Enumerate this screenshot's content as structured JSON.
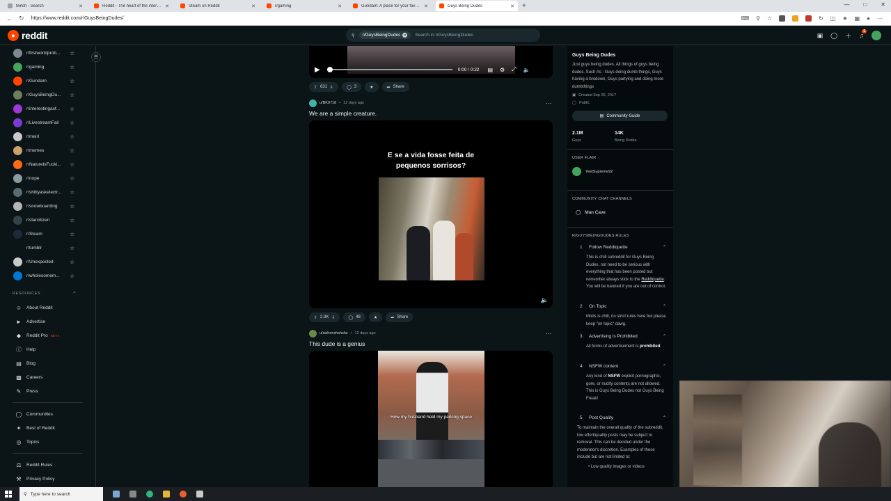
{
  "browser": {
    "tabs": [
      {
        "title": "twitch - Search",
        "color": "#9aa0a6",
        "active": false
      },
      {
        "title": "Reddit - The heart of the internet",
        "color": "#ff4500",
        "active": false
      },
      {
        "title": "Steam on Reddit",
        "color": "#ff4500",
        "active": false
      },
      {
        "title": "r/gaming",
        "color": "#ff4500",
        "active": false
      },
      {
        "title": "Gundam: A place for your favorit...",
        "color": "#ff4500",
        "active": false
      },
      {
        "title": "Guys Being Dudes",
        "color": "#ff4500",
        "active": true
      }
    ],
    "url": "https://www.reddit.com/r/GuysBeingDudes/"
  },
  "header": {
    "logo": "reddit",
    "search_chip": "r/GuysBeingDudes",
    "search_placeholder": "Search in r/GuysBeingDudes",
    "notif_count": "1"
  },
  "sidebar": {
    "communities": [
      {
        "name": "r/firstworldprob...",
        "color": "#7a8a90"
      },
      {
        "name": "r/gaming",
        "color": "#46a35e"
      },
      {
        "name": "r/Gundam",
        "color": "#ff4500"
      },
      {
        "name": "r/GuysBeingDu...",
        "color": "#6b7f5a"
      },
      {
        "name": "r/interestingasf...",
        "color": "#9b3ad6"
      },
      {
        "name": "r/LivestreamFail",
        "color": "#7a3ad6"
      },
      {
        "name": "r/meirl",
        "color": "#c9c9c9"
      },
      {
        "name": "r/memes",
        "color": "#c9a26a"
      },
      {
        "name": "r/NatureIsFucki...",
        "color": "#ff6a13"
      },
      {
        "name": "r/nope",
        "color": "#8a9aa2"
      },
      {
        "name": "r/shittyaskelectr...",
        "color": "#5a6a70"
      },
      {
        "name": "r/snowboarding",
        "color": "#b5b5b5"
      },
      {
        "name": "r/starcitizen",
        "color": "#344248"
      },
      {
        "name": "r/Steam",
        "color": "#1e2a3a"
      },
      {
        "name": "r/tumblr",
        "color": "#0b1416"
      },
      {
        "name": "r/Unexpected",
        "color": "#c9c9c9"
      },
      {
        "name": "r/wholesomem...",
        "color": "#0079d3"
      }
    ],
    "resources_label": "RESOURCES",
    "resources": [
      {
        "label": "About Reddit",
        "icon": "reddit-icon"
      },
      {
        "label": "Advertise",
        "icon": "megaphone-icon"
      },
      {
        "label": "Reddit Pro",
        "icon": "reddit-pro-icon",
        "badge": "BETA"
      },
      {
        "label": "Help",
        "icon": "help-icon"
      },
      {
        "label": "Blog",
        "icon": "blog-icon"
      },
      {
        "label": "Careers",
        "icon": "careers-icon"
      },
      {
        "label": "Press",
        "icon": "press-icon"
      }
    ],
    "more": [
      {
        "label": "Communities",
        "icon": "communities-icon"
      },
      {
        "label": "Best of Reddit",
        "icon": "best-icon"
      },
      {
        "label": "Topics",
        "icon": "topics-icon"
      }
    ],
    "legal": [
      {
        "label": "Reddit Rules",
        "icon": "rules-icon"
      },
      {
        "label": "Privacy Policy",
        "icon": "privacy-icon"
      }
    ]
  },
  "video_top": {
    "time": "0:00 / 0:22",
    "votes": "631",
    "comments": "3",
    "share": "Share"
  },
  "posts": [
    {
      "user": "u/BK0718",
      "age": "12 days ago",
      "title": "We are a simple creature.",
      "caption": "E se a vida fosse feita de pequenos sorrisos?",
      "votes": "2.3K",
      "comments": "48",
      "share": "Share"
    },
    {
      "user": "u/sishenshshshs",
      "age": "12 days ago",
      "title": "This dude is a genius",
      "subtitle": "How my husband held my parking space"
    }
  ],
  "right_sidebar": {
    "title": "Guys Being Dudes",
    "description": "Just guys being dudes. All things of guys being dudes. Such As : Guys doing dumb things, Guys having a brodown, Guys partying and doing more dumbthings",
    "created": "Created Sep 26, 2017",
    "visibility": "Public",
    "guide_label": "Community Guide",
    "members": "2.1M",
    "members_label": "Guys",
    "online": "14K",
    "online_label": "Being Dudes",
    "flair_head": "USER FLAIR",
    "flair_user": "YeetSupreme92",
    "chat_head": "COMMUNITY CHAT CHANNELS",
    "chat_channel": "Man Cave",
    "rules_head": "R/GUYSBEINGDUDES RULES",
    "rules": [
      {
        "num": "1",
        "title": "Follow Reddiquette",
        "body": "This is chill subreddit for Guys Being Dudes, not need to be serious with everything that has been posted but remember always stick to the",
        "link": "Reddiquette",
        "body_after": ". You will be banned if you are out of control."
      },
      {
        "num": "2",
        "title": "On Topic",
        "body": "Mods is chill, no strict rules here but please keep \"on topic\" dawg."
      },
      {
        "num": "3",
        "title": "Advertising is Prohibited",
        "body": "All forms of advertisement is",
        "bold": "prohibited",
        "body_after": "."
      },
      {
        "num": "4",
        "title": "NSFW content",
        "body": "Any kind of",
        "bold": "NSFW",
        "body_after": " explicit pornographic, gore, or nudity contents are not allowed. This is Guys Being Dudes not Guys Being Freak!"
      },
      {
        "num": "5",
        "title": "Post Quality",
        "body": "To maintain the overall quality of the subreddit, low effort/quality posts may be subject to removal. This can be decided under the moderator's discretion. Examples of these include but are not limited to:",
        "bullet": "Low quality images or videos"
      }
    ]
  },
  "taskbar": {
    "search_placeholder": "Type here to search"
  }
}
